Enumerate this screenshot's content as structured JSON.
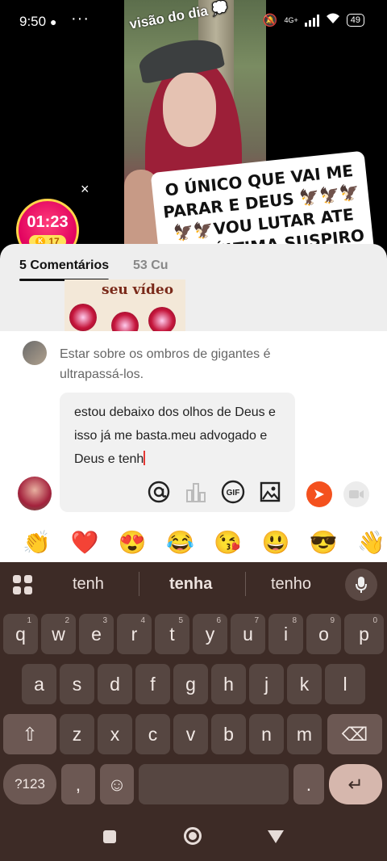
{
  "status_bar": {
    "time": "9:50",
    "more": "···",
    "network": "4G+",
    "battery": "49"
  },
  "video": {
    "caption": "visão do dia 💭",
    "overlay_text": "O ÚNICO QUE VAI ME PARAR E DEUS 🦅🦅🦅🦅🦅VOU LUTAR ATE MEU ÚLTIMA SUSPIRO DE VIDA 🍃",
    "close": "×"
  },
  "timer": {
    "time": "01:23",
    "coins": "17",
    "coin_symbol": "K"
  },
  "comment_tabs": {
    "active": "5 Comentários",
    "other": "53 Cu"
  },
  "thumbnail": {
    "text": "seu vídeo"
  },
  "reply": {
    "context_text": "Estar sobre os ombros de gigantes é ultrapassá-los.",
    "input_value": "estou debaixo dos olhos de Deus e isso já me basta.meu advogado e Deus e tenh"
  },
  "input_tools": [
    "at-icon",
    "chart-icon",
    "gif-icon",
    "image-icon"
  ],
  "input_labels": {
    "at": "@",
    "gif": "GIF"
  },
  "emojis": [
    "👏",
    "❤️",
    "😍",
    "😂",
    "😘",
    "😃",
    "😎",
    "👋"
  ],
  "keyboard": {
    "suggestions": [
      "tenh",
      "tenha",
      "tenho"
    ],
    "row1": [
      [
        "q",
        "1"
      ],
      [
        "w",
        "2"
      ],
      [
        "e",
        "3"
      ],
      [
        "r",
        "4"
      ],
      [
        "t",
        "5"
      ],
      [
        "y",
        "6"
      ],
      [
        "u",
        "7"
      ],
      [
        "i",
        "8"
      ],
      [
        "o",
        "9"
      ],
      [
        "p",
        "0"
      ]
    ],
    "row2": [
      "a",
      "s",
      "d",
      "f",
      "g",
      "h",
      "j",
      "k",
      "l"
    ],
    "row3": [
      "z",
      "x",
      "c",
      "v",
      "b",
      "n",
      "m"
    ],
    "symbols": "?123",
    "comma": ",",
    "period": ".",
    "emoji_key": "☺",
    "enter": "↵",
    "shift": "⇧",
    "backspace": "⌫"
  },
  "colors": {
    "accent": "#f4511e",
    "timer_pink": "#e0005e",
    "keyboard_bg": "#3d2b26"
  }
}
